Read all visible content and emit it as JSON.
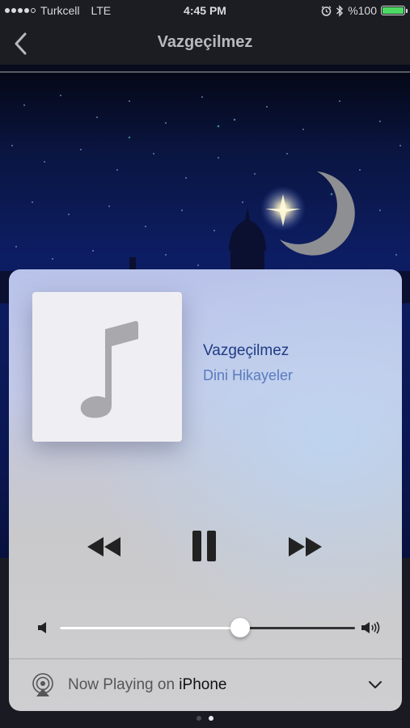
{
  "status_bar": {
    "carrier": "Turkcell",
    "network": "LTE",
    "time": "4:45 PM",
    "battery": "%100",
    "battery_level": 1.0,
    "icons": [
      "alarm-icon",
      "bluetooth-icon",
      "battery-icon"
    ]
  },
  "nav": {
    "title": "Vazgeçilmez",
    "back_icon": "chevron-left-icon"
  },
  "now_playing": {
    "title": "Vazgeçilmez",
    "artist": "Dini Hikayeler",
    "artwork_icon": "music-note-icon",
    "controls": {
      "rewind_icon": "rewind-icon",
      "pause_icon": "pause-icon",
      "forward_icon": "fast-forward-icon"
    },
    "volume_level": 0.61
  },
  "output": {
    "prefix": "Now Playing on ",
    "device": "iPhone",
    "icon": "airplay-icon",
    "expand_icon": "chevron-down-icon"
  },
  "pager": {
    "page_count": 2,
    "active_page": 2
  },
  "colors": {
    "title_accent": "#1f3b85",
    "artist_accent": "#5b7bbf",
    "battery_fill": "#4cd964"
  }
}
